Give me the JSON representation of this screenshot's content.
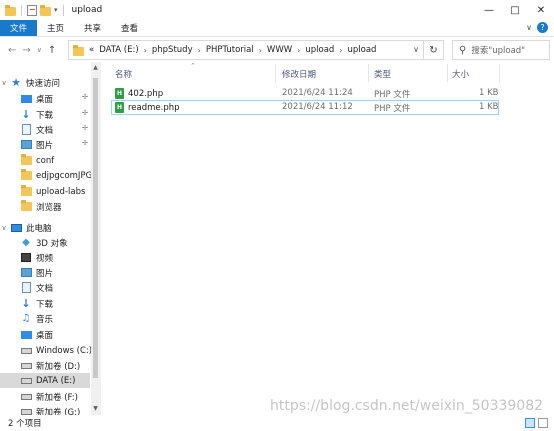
{
  "window": {
    "title": "upload"
  },
  "ribbon": {
    "tabs": [
      "文件",
      "主页",
      "共享",
      "查看"
    ]
  },
  "address": {
    "prefix": "«",
    "crumbs": [
      "DATA (E:)",
      "phpStudy",
      "PHPTutorial",
      "WWW",
      "upload",
      "upload"
    ]
  },
  "search": {
    "placeholder": "搜索\"upload\""
  },
  "sidebar": {
    "items": [
      {
        "label": "快速访问",
        "icon": "star-icon"
      },
      {
        "label": "桌面",
        "icon": "desktop-icon",
        "pinned": true
      },
      {
        "label": "下载",
        "icon": "download-icon",
        "pinned": true
      },
      {
        "label": "文档",
        "icon": "documents-icon",
        "pinned": true
      },
      {
        "label": "图片",
        "icon": "pictures-icon",
        "pinned": true
      },
      {
        "label": "conf",
        "icon": "folder-icon"
      },
      {
        "label": "edjpgcomJPG",
        "icon": "folder-icon"
      },
      {
        "label": "upload-labs",
        "icon": "folder-icon"
      },
      {
        "label": "浏览器",
        "icon": "folder-icon"
      },
      {
        "label": "此电脑",
        "icon": "computer-icon"
      },
      {
        "label": "3D 对象",
        "icon": "cube-icon"
      },
      {
        "label": "视频",
        "icon": "video-icon"
      },
      {
        "label": "图片",
        "icon": "pictures-icon"
      },
      {
        "label": "文档",
        "icon": "documents-icon"
      },
      {
        "label": "下载",
        "icon": "download-icon"
      },
      {
        "label": "音乐",
        "icon": "music-icon"
      },
      {
        "label": "桌面",
        "icon": "desktop-icon"
      },
      {
        "label": "Windows (C:)",
        "icon": "drive-icon"
      },
      {
        "label": "新加卷 (D:)",
        "icon": "drive-icon"
      },
      {
        "label": "DATA (E:)",
        "icon": "drive-icon",
        "selected": true
      },
      {
        "label": "新加卷 (F:)",
        "icon": "drive-icon"
      },
      {
        "label": "新加卷 (G:)",
        "icon": "drive-icon"
      }
    ]
  },
  "columns": {
    "name": "名称",
    "date": "修改日期",
    "type": "类型",
    "size": "大小"
  },
  "files": [
    {
      "name": "402.php",
      "date": "2021/6/24 11:24",
      "type": "PHP 文件",
      "size": "1 KB"
    },
    {
      "name": "readme.php",
      "date": "2021/6/24 11:12",
      "type": "PHP 文件",
      "size": "1 KB"
    }
  ],
  "status": {
    "count": "2 个项目"
  },
  "watermark": "https://blog.csdn.net/weixin_50339082",
  "colors": {
    "accent": "#1979ca",
    "selection_border": "#99d1ff",
    "folder": "#f3c65a",
    "php_icon": "#2e9e47"
  }
}
